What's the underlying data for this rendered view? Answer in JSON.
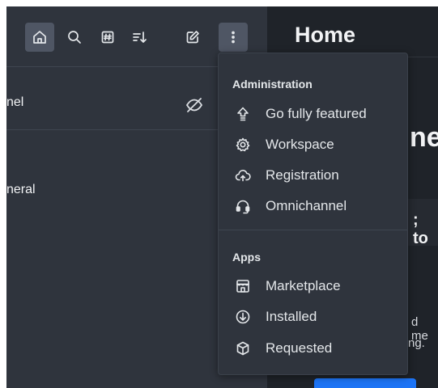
{
  "sidebar": {
    "toolbar": {
      "home": "home-icon",
      "search": "search-icon",
      "directory": "directory-icon",
      "sort": "sort-icon",
      "create": "create-new-icon",
      "kebab": "kebab-menu-icon"
    },
    "rows": [
      {
        "label": "nel",
        "icon": "eye-off-icon"
      },
      {
        "label": "neral"
      }
    ]
  },
  "main": {
    "title": "Home",
    "heading_fragment": "ne",
    "subheading_fragment": "; to",
    "text_line1": "d me",
    "text_line2": "ng."
  },
  "menu": {
    "sections": [
      {
        "heading": "Administration",
        "items": [
          {
            "label": "Go fully featured",
            "icon": "arrow-up-icon"
          },
          {
            "label": "Workspace",
            "icon": "gear-icon"
          },
          {
            "label": "Registration",
            "icon": "cloud-upload-icon"
          },
          {
            "label": "Omnichannel",
            "icon": "headset-icon"
          }
        ]
      },
      {
        "heading": "Apps",
        "items": [
          {
            "label": "Marketplace",
            "icon": "store-icon"
          },
          {
            "label": "Installed",
            "icon": "download-circle-icon"
          },
          {
            "label": "Requested",
            "icon": "cube-icon"
          }
        ]
      }
    ]
  },
  "colors": {
    "sidebar_bg": "#2f343d",
    "main_bg": "#1f2329",
    "menu_bg": "#2f343d",
    "active_button": "#4f5664",
    "primary": "#1d74f5"
  }
}
